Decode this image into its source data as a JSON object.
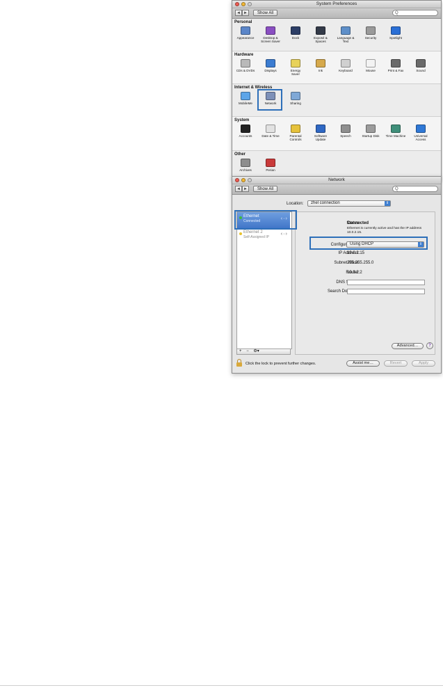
{
  "window1": {
    "title": "System Preferences",
    "toolbar": {
      "back": "◄",
      "forward": "►",
      "show_all": "Show All",
      "search_placeholder": "Q"
    },
    "sections": [
      {
        "title": "Personal",
        "items": [
          {
            "label": "Appearance",
            "icon": "appearance-icon",
            "color": "#5b86c9"
          },
          {
            "label": "Desktop &\nScreen Saver",
            "icon": "desktop-icon",
            "color": "#8a4fc2"
          },
          {
            "label": "Dock",
            "icon": "dock-icon",
            "color": "#2c3e66"
          },
          {
            "label": "Exposé &\nSpaces",
            "icon": "expose-icon",
            "color": "#333a48"
          },
          {
            "label": "Language &\nText",
            "icon": "language-icon",
            "color": "#5e8fc9"
          },
          {
            "label": "Security",
            "icon": "security-icon",
            "color": "#9a9a9a"
          },
          {
            "label": "Spotlight",
            "icon": "spotlight-icon",
            "color": "#2a6fd6"
          }
        ]
      },
      {
        "title": "Hardware",
        "items": [
          {
            "label": "CDs & DVDs",
            "icon": "cd-icon",
            "color": "#b9b9b9"
          },
          {
            "label": "Displays",
            "icon": "displays-icon",
            "color": "#3b7cd1"
          },
          {
            "label": "Energy\nSaver",
            "icon": "energy-icon",
            "color": "#e8d25a"
          },
          {
            "label": "Ink",
            "icon": "ink-icon",
            "color": "#d6a94c"
          },
          {
            "label": "Keyboard",
            "icon": "keyboard-icon",
            "color": "#d0d0d0"
          },
          {
            "label": "Mouse",
            "icon": "mouse-icon",
            "color": "#f3f3f3"
          },
          {
            "label": "Print & Fax",
            "icon": "print-icon",
            "color": "#6a6a6a"
          },
          {
            "label": "Sound",
            "icon": "sound-icon",
            "color": "#6a6a6a"
          }
        ]
      },
      {
        "title": "Internet & Wireless",
        "items": [
          {
            "label": "MobileMe",
            "icon": "mobileme-icon",
            "color": "#5da5e8"
          },
          {
            "label": "Network",
            "icon": "network-icon",
            "color": "#7d90b8"
          },
          {
            "label": "Sharing",
            "icon": "sharing-icon",
            "color": "#7fa8d6"
          }
        ]
      },
      {
        "title": "System",
        "items": [
          {
            "label": "Accounts",
            "icon": "accounts-icon",
            "color": "#222222"
          },
          {
            "label": "Date & Time",
            "icon": "datetime-icon",
            "color": "#e2e2e2"
          },
          {
            "label": "Parental\nControls",
            "icon": "parental-icon",
            "color": "#e6c23c"
          },
          {
            "label": "Software\nUpdate",
            "icon": "update-icon",
            "color": "#2f68c4"
          },
          {
            "label": "Speech",
            "icon": "speech-icon",
            "color": "#8f8f8f"
          },
          {
            "label": "Startup Disk",
            "icon": "startup-icon",
            "color": "#9c9c9c"
          },
          {
            "label": "Time Machine",
            "icon": "timemachine-icon",
            "color": "#3f8f7a"
          },
          {
            "label": "Universal\nAccess",
            "icon": "universal-icon",
            "color": "#2f78d6"
          }
        ]
      },
      {
        "title": "Other",
        "items": [
          {
            "label": "Archives",
            "icon": "archives-icon",
            "color": "#8d8d8d"
          },
          {
            "label": "Perian",
            "icon": "perian-icon",
            "color": "#c93a3a"
          }
        ]
      }
    ]
  },
  "window2": {
    "title": "Network",
    "toolbar": {
      "back": "◄",
      "forward": "►",
      "show_all": "Show All",
      "search_placeholder": "Q"
    },
    "location_label": "Location:",
    "location_value": "zhel connection",
    "services": [
      {
        "name": "Ethernet",
        "status": "Connected",
        "dot": "#3dbb3d"
      },
      {
        "name": "Ethernet 2",
        "status": "Self-Assigned IP",
        "dot": "#e8c22e"
      }
    ],
    "list_controls": {
      "add": "+",
      "remove": "−",
      "gear": "⚙︎▾"
    },
    "status_label": "Status:",
    "status_value": "Connected",
    "status_desc": "Ethernet is currently active and has the IP address 10.0.2.15.",
    "configure_label": "Configure IPv4:",
    "configure_value": "Using DHCP",
    "ip_label": "IP Address:",
    "ip_value": "10.0.2.15",
    "subnet_label": "Subnet Mask:",
    "subnet_value": "255.255.255.0",
    "router_label": "Router:",
    "router_value": "10.0.2.2",
    "dns_label": "DNS Server:",
    "search_domains_label": "Search Domains:",
    "advanced_button": "Advanced…",
    "help_button": "?",
    "lock_text": "Click the lock to prevent further changes.",
    "assist_button": "Assist me…",
    "revert_button": "Revert",
    "apply_button": "Apply"
  }
}
